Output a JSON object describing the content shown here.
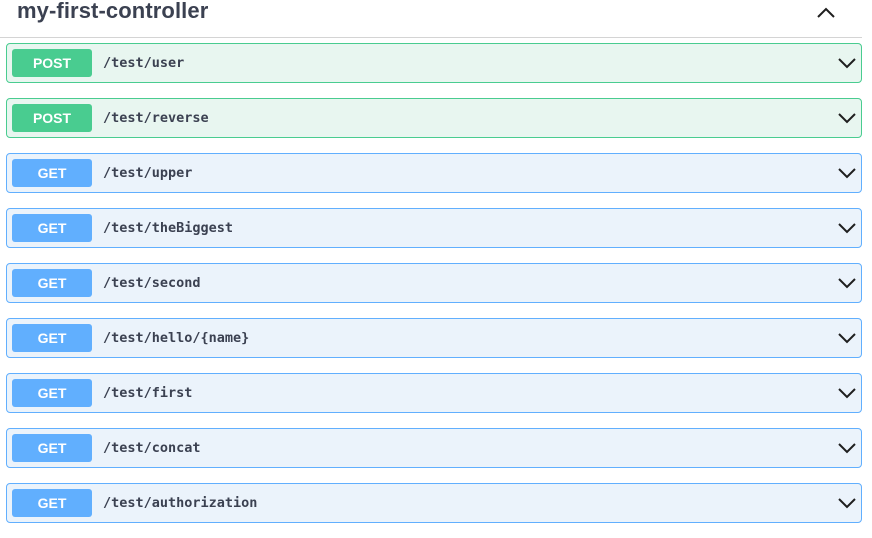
{
  "section": {
    "title": "my-first-controller",
    "collapse_icon": "chevron-up-icon"
  },
  "operations": [
    {
      "method": "POST",
      "path": "/test/user"
    },
    {
      "method": "POST",
      "path": "/test/reverse"
    },
    {
      "method": "GET",
      "path": "/test/upper"
    },
    {
      "method": "GET",
      "path": "/test/theBiggest"
    },
    {
      "method": "GET",
      "path": "/test/second"
    },
    {
      "method": "GET",
      "path": "/test/hello/{name}"
    },
    {
      "method": "GET",
      "path": "/test/first"
    },
    {
      "method": "GET",
      "path": "/test/concat"
    },
    {
      "method": "GET",
      "path": "/test/authorization"
    }
  ],
  "colors": {
    "post_accent": "#49cc90",
    "post_background": "#e8f6f0",
    "get_accent": "#61affe",
    "get_background": "#ebf3fb",
    "text": "#3b4151"
  }
}
